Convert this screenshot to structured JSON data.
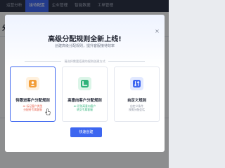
{
  "nav": {
    "tabs": [
      {
        "label": "运营分析",
        "active": false
      },
      {
        "label": "接待配置",
        "active": true
      },
      {
        "label": "企业管理",
        "active": false
      },
      {
        "label": "智能数据",
        "active": false
      },
      {
        "label": "工单管理",
        "active": false
      }
    ]
  },
  "background": {
    "heading": "分配"
  },
  "modal": {
    "close_glyph": "×",
    "title": "高级分配规则全新上线!",
    "subtitle": "创建高级分配规则，提升客服接待效率",
    "divider_text": "请选择需要搭建的规则创建方式",
    "cards": [
      {
        "title": "待跟进客户分配规则",
        "desc_line1": "AI 标记客户类型",
        "desc_line2": "分配给专属客服",
        "icon": "user-icon",
        "icon_color": "#f29d38",
        "icon_bg": "#fff1de",
        "selected": true
      },
      {
        "title": "高意向客户分配规则",
        "desc_line1": "AI 识别高意向客户",
        "desc_line2": "转交专属客服",
        "icon": "chart-icon",
        "icon_color": "#2fb37a",
        "icon_bg": "#dcf5e8",
        "selected": false
      },
      {
        "title": "自定义规则",
        "desc_line1": "自定义条件",
        "desc_line2": "按需分配会话",
        "icon": "swap-icon",
        "icon_color": "#3d66f0",
        "icon_bg": "#e2e9ff",
        "selected": false
      }
    ],
    "create_button": "快速创建"
  },
  "colors": {
    "accent": "#3d66f0",
    "nav_bg": "#2b3246",
    "highlight_red": "#e8604c",
    "highlight_green": "#2fb37a"
  }
}
